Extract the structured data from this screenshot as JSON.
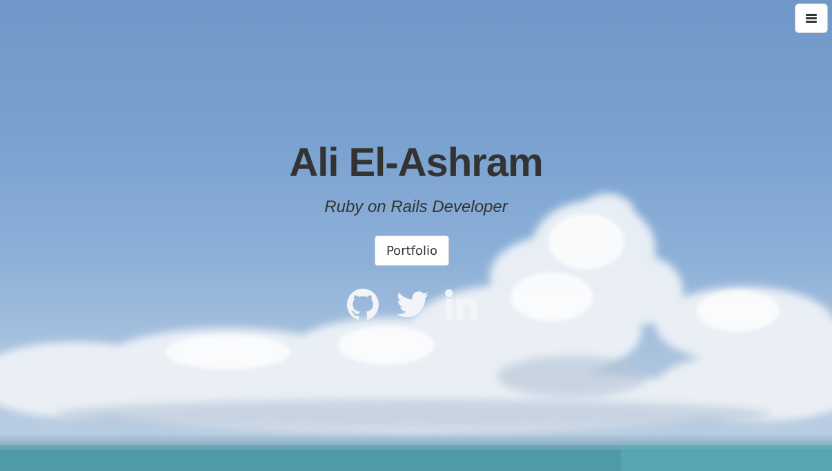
{
  "hero": {
    "name": "Ali El-Ashram",
    "tagline": "Ruby on Rails Developer",
    "portfolio_label": "Portfolio"
  },
  "social": {
    "items": [
      {
        "icon": "github-icon"
      },
      {
        "icon": "twitter-icon"
      },
      {
        "icon": "linkedin-icon"
      }
    ]
  },
  "nav": {
    "menu_icon": "hamburger-menu-icon"
  },
  "colors": {
    "text": "#333333",
    "button_bg": "#ffffff",
    "sky": "#7aa2d0",
    "sea": "#4f9aa8",
    "icon": "#f2f4f7"
  }
}
